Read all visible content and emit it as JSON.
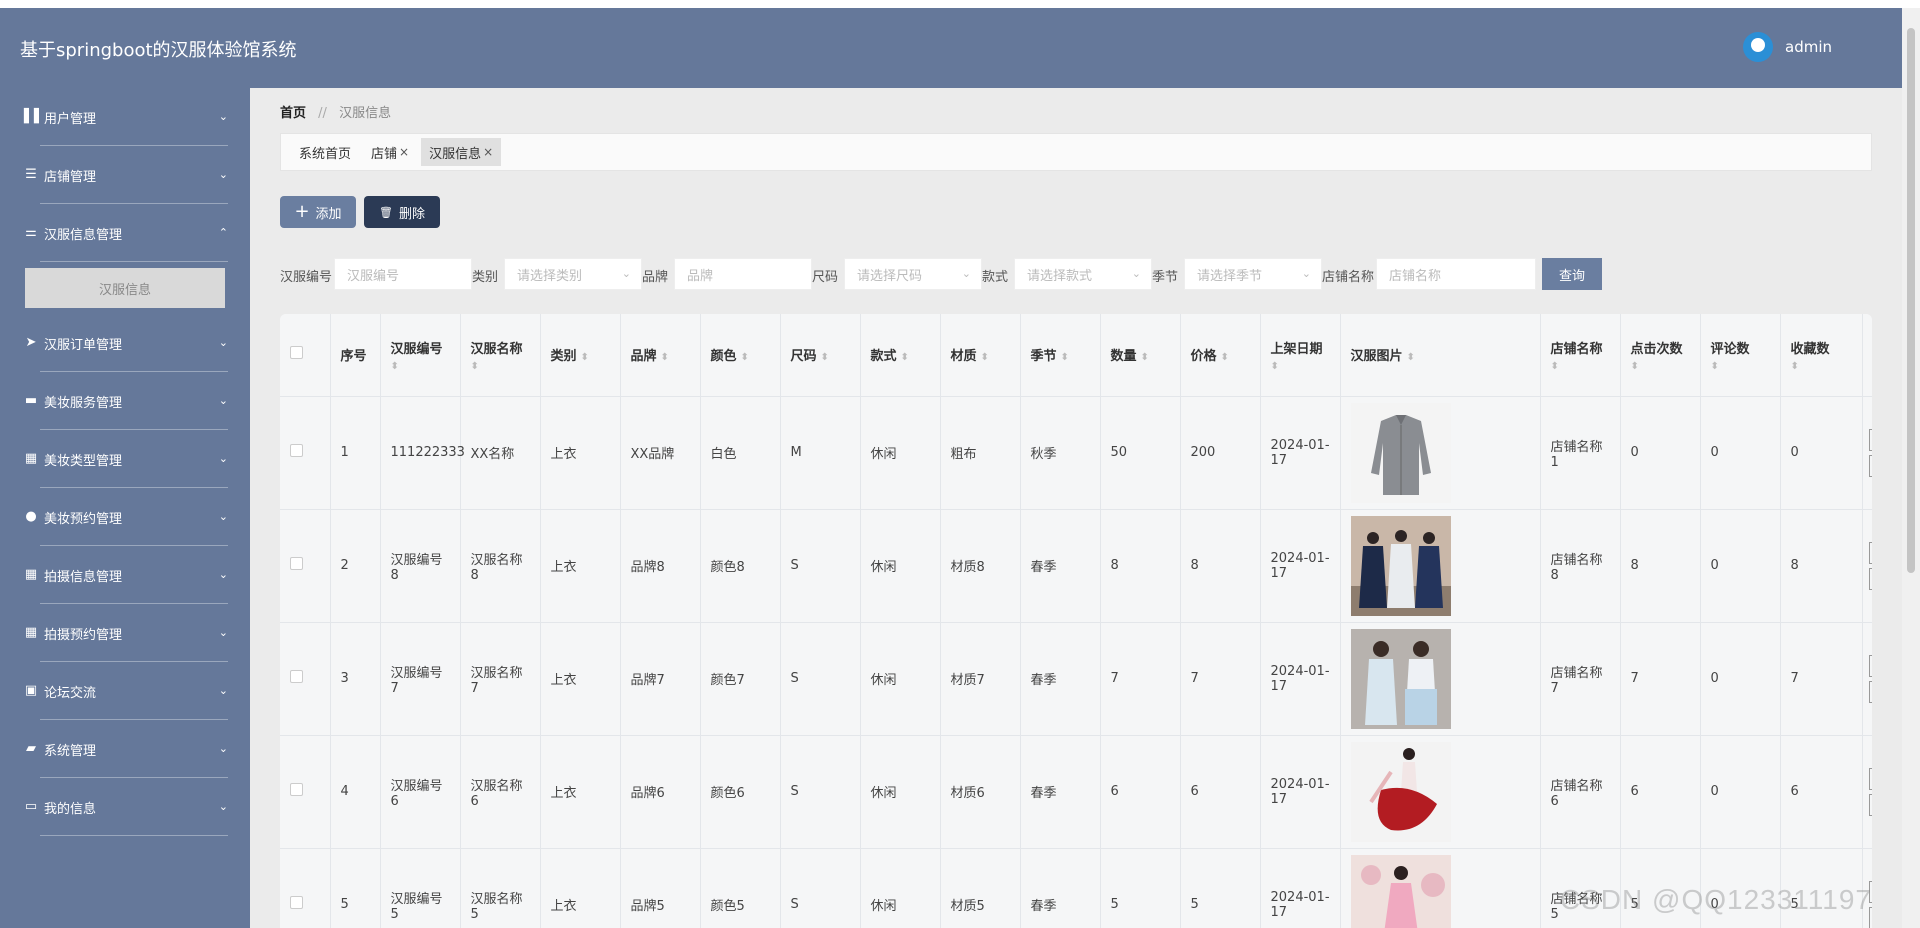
{
  "header": {
    "title": "基于springboot的汉服体验馆系统",
    "username": "admin"
  },
  "sidebar": {
    "items": [
      {
        "label": "用户管理",
        "icon": "library-icon",
        "glyph": "▌▌",
        "chevron": "⌄"
      },
      {
        "label": "店铺管理",
        "icon": "menu-icon",
        "glyph": "☰",
        "chevron": "⌄"
      },
      {
        "label": "汉服信息管理",
        "icon": "sliders-icon",
        "glyph": "⚌",
        "chevron": "⌃"
      },
      {
        "label": "汉服订单管理",
        "icon": "send-icon",
        "glyph": "➤",
        "chevron": "⌄"
      },
      {
        "label": "美妆服务管理",
        "icon": "ticket-icon",
        "glyph": "▬",
        "chevron": "⌄"
      },
      {
        "label": "美妆类型管理",
        "icon": "grid-icon",
        "glyph": "▦",
        "chevron": "⌄"
      },
      {
        "label": "美妆预约管理",
        "icon": "user-icon",
        "glyph": "●",
        "chevron": "⌄"
      },
      {
        "label": "拍摄信息管理",
        "icon": "grid-icon",
        "glyph": "▦",
        "chevron": "⌄"
      },
      {
        "label": "拍摄预约管理",
        "icon": "grid-icon",
        "glyph": "▦",
        "chevron": "⌄"
      },
      {
        "label": "论坛交流",
        "icon": "briefcase-icon",
        "glyph": "▣",
        "chevron": "⌄"
      },
      {
        "label": "系统管理",
        "icon": "chat-icon",
        "glyph": "▰",
        "chevron": "⌄"
      },
      {
        "label": "我的信息",
        "icon": "id-card-icon",
        "glyph": "▭",
        "chevron": "⌄"
      }
    ],
    "submenu_active": "汉服信息"
  },
  "breadcrumb": {
    "home": "首页",
    "sep": "//",
    "current": "汉服信息"
  },
  "tabs": [
    {
      "label": "系统首页",
      "close": ""
    },
    {
      "label": "店铺",
      "close": "×"
    },
    {
      "label": "汉服信息",
      "close": "×"
    }
  ],
  "toolbar": {
    "add_label": "添加",
    "add_icon": "+",
    "delete_label": "删除",
    "delete_icon": "🗑"
  },
  "filters": {
    "code_label": "汉服编号",
    "code_placeholder": "汉服编号",
    "category_label": "类别",
    "category_placeholder": "请选择类别",
    "brand_label": "品牌",
    "brand_placeholder": "品牌",
    "size_label": "尺码",
    "size_placeholder": "请选择尺码",
    "style_label": "款式",
    "style_placeholder": "请选择款式",
    "season_label": "季节",
    "season_placeholder": "请选择季节",
    "shop_label": "店铺名称",
    "shop_placeholder": "店铺名称",
    "query_label": "查询",
    "dropdown_glyph": "⌄"
  },
  "table": {
    "sort_glyph": "⬍",
    "headers": [
      "序号",
      "汉服编号",
      "汉服名称",
      "类别",
      "品牌",
      "颜色",
      "尺码",
      "款式",
      "材质",
      "季节",
      "数量",
      "价格",
      "上架日期",
      "汉服图片",
      "店铺名称",
      "点击次数",
      "评论数",
      "收藏数"
    ],
    "rows": [
      {
        "idx": "1",
        "code": "111222333",
        "name": "XX名称",
        "cat": "上衣",
        "brand": "XX品牌",
        "color": "白色",
        "size": "M",
        "style": "休闲",
        "material": "粗布",
        "season": "秋季",
        "qty": "50",
        "price": "200",
        "date": "2024-01-17",
        "img": "gray-shirt",
        "shop": "店铺名称1",
        "clicks": "0",
        "comments": "0",
        "favs": "0"
      },
      {
        "idx": "2",
        "code": "汉服编号8",
        "name": "汉服名称8",
        "cat": "上衣",
        "brand": "品牌8",
        "color": "颜色8",
        "size": "S",
        "style": "休闲",
        "material": "材质8",
        "season": "春季",
        "qty": "8",
        "price": "8",
        "date": "2024-01-17",
        "img": "navy-group",
        "shop": "店铺名称8",
        "clicks": "8",
        "comments": "0",
        "favs": "8"
      },
      {
        "idx": "3",
        "code": "汉服编号7",
        "name": "汉服名称7",
        "cat": "上衣",
        "brand": "品牌7",
        "color": "颜色7",
        "size": "S",
        "style": "休闲",
        "material": "材质7",
        "season": "春季",
        "qty": "7",
        "price": "7",
        "date": "2024-01-17",
        "img": "lightblue-pair",
        "shop": "店铺名称7",
        "clicks": "7",
        "comments": "0",
        "favs": "7"
      },
      {
        "idx": "4",
        "code": "汉服编号6",
        "name": "汉服名称6",
        "cat": "上衣",
        "brand": "品牌6",
        "color": "颜色6",
        "size": "S",
        "style": "休闲",
        "material": "材质6",
        "season": "春季",
        "qty": "6",
        "price": "6",
        "date": "2024-01-17",
        "img": "red-dancer",
        "shop": "店铺名称6",
        "clicks": "6",
        "comments": "0",
        "favs": "6"
      },
      {
        "idx": "5",
        "code": "汉服编号5",
        "name": "汉服名称5",
        "cat": "上衣",
        "brand": "品牌5",
        "color": "颜色5",
        "size": "S",
        "style": "休闲",
        "material": "材质5",
        "season": "春季",
        "qty": "5",
        "price": "5",
        "date": "2024-01-17",
        "img": "pink-dress",
        "shop": "店铺名称5",
        "clicks": "5",
        "comments": "0",
        "favs": "5"
      }
    ]
  },
  "watermark": "CSDN @QQ123311197"
}
